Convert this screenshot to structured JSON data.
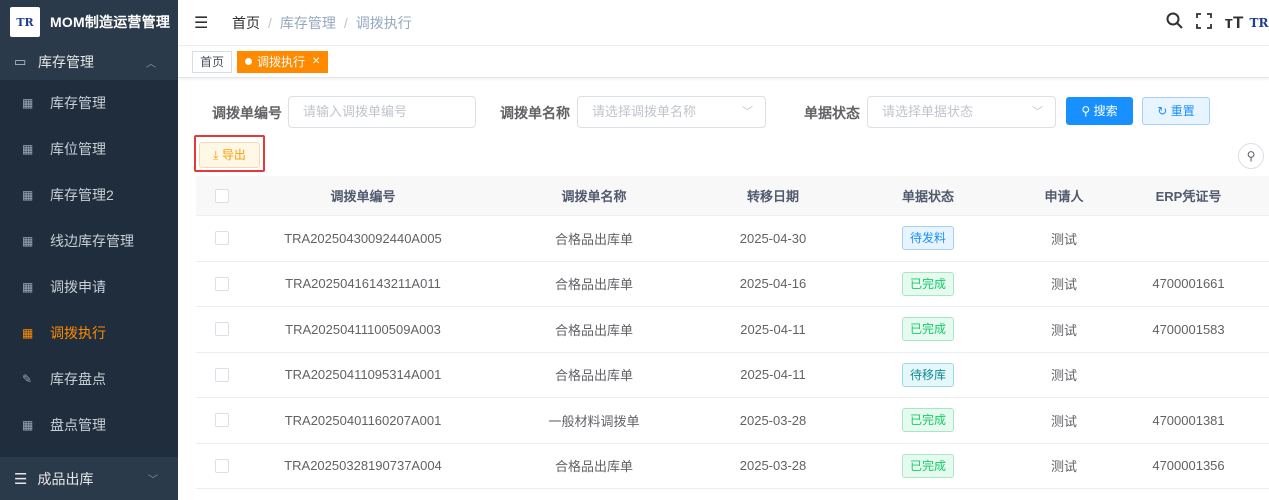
{
  "brand": {
    "logo_text": "TR",
    "title": "MOM制造运营管理"
  },
  "sidebar": {
    "group": {
      "label": "库存管理"
    },
    "items": [
      {
        "label": "库存管理",
        "icon": "table-icon",
        "active": false
      },
      {
        "label": "库位管理",
        "icon": "table-icon",
        "active": false
      },
      {
        "label": "库存管理2",
        "icon": "table-icon",
        "active": false
      },
      {
        "label": "线边库存管理",
        "icon": "table-icon",
        "active": false
      },
      {
        "label": "调拨申请",
        "icon": "table-icon",
        "active": false
      },
      {
        "label": "调拨执行",
        "icon": "table-icon",
        "active": true
      },
      {
        "label": "库存盘点",
        "icon": "edit-icon",
        "active": false
      },
      {
        "label": "盘点管理",
        "icon": "table-icon",
        "active": false
      }
    ],
    "bottom_group": {
      "label": "成品出库"
    }
  },
  "breadcrumb": {
    "home": "首页",
    "level1": "库存管理",
    "level2": "调拨执行",
    "sep": "/"
  },
  "tags": {
    "home": "首页",
    "active": "调拨执行"
  },
  "search": {
    "code_label": "调拨单编号",
    "code_placeholder": "请输入调拨单编号",
    "name_label": "调拨单名称",
    "name_placeholder": "请选择调拨单名称",
    "status_label": "单据状态",
    "status_placeholder": "请选择单据状态",
    "search_btn": "搜索",
    "reset_btn": "重置"
  },
  "toolbar": {
    "export_label": "导出"
  },
  "table": {
    "headers": {
      "code": "调拨单编号",
      "name": "调拨单名称",
      "date": "转移日期",
      "status": "单据状态",
      "user": "申请人",
      "erp": "ERP凭证号"
    },
    "rows": [
      {
        "code": "TRA20250430092440A005",
        "name": "合格品出库单",
        "date": "2025-04-30",
        "status": "待发料",
        "user": "测试",
        "erp": ""
      },
      {
        "code": "TRA20250416143211A011",
        "name": "合格品出库单",
        "date": "2025-04-16",
        "status": "已完成",
        "user": "测试",
        "erp": "4700001661"
      },
      {
        "code": "TRA20250411100509A003",
        "name": "合格品出库单",
        "date": "2025-04-11",
        "status": "已完成",
        "user": "测试",
        "erp": "4700001583"
      },
      {
        "code": "TRA20250411095314A001",
        "name": "合格品出库单",
        "date": "2025-04-11",
        "status": "待移库",
        "user": "测试",
        "erp": ""
      },
      {
        "code": "TRA20250401160207A001",
        "name": "一般材料调拨单",
        "date": "2025-03-28",
        "status": "已完成",
        "user": "测试",
        "erp": "4700001381"
      },
      {
        "code": "TRA20250328190737A004",
        "name": "合格品出库单",
        "date": "2025-03-28",
        "status": "已完成",
        "user": "测试",
        "erp": "4700001356"
      }
    ]
  },
  "colors": {
    "sidebar_bg": "#1f2d3d",
    "accent": "#ff8a00",
    "primary": "#1890ff",
    "success": "#13ce66",
    "highlight": "#e53935"
  }
}
